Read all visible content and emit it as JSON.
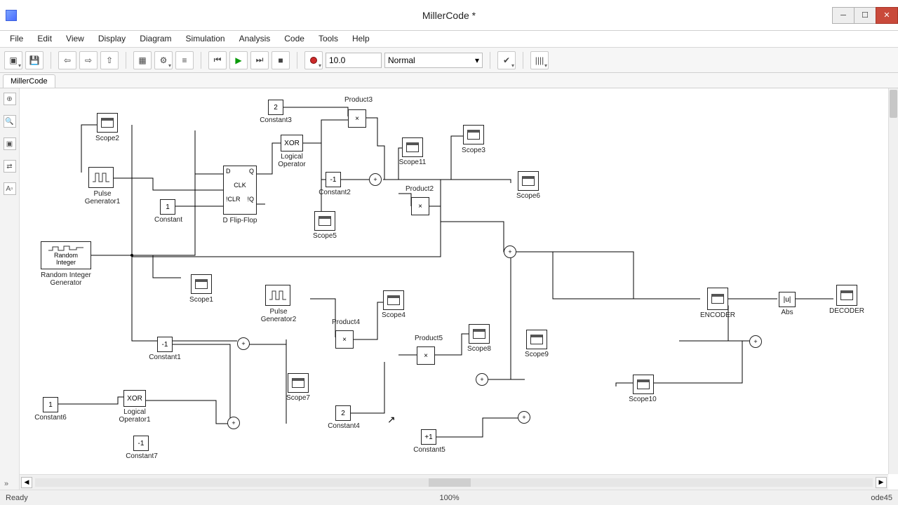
{
  "window": {
    "title": "MillerCode *"
  },
  "menu": [
    "File",
    "Edit",
    "View",
    "Display",
    "Diagram",
    "Simulation",
    "Analysis",
    "Code",
    "Tools",
    "Help"
  ],
  "toolbar": {
    "sim_time": "10.0",
    "sim_mode": "Normal"
  },
  "tab": {
    "label": "MillerCode"
  },
  "status": {
    "left": "Ready",
    "zoom": "100%",
    "solver": "ode45"
  },
  "blocks": {
    "scope2": "Scope2",
    "pulse1": "Pulse\nGenerator1",
    "rand_int_body": "Random\nInteger",
    "rand_int": "Random Integer\nGenerator",
    "constant": "Constant",
    "constant_val": "1",
    "constant1": "Constant1",
    "constant1_val": "-1",
    "constant2": "Constant2",
    "constant2_val": "-1",
    "constant3": "Constant3",
    "constant3_val": "2",
    "constant4": "Constant4",
    "constant4_val": "2",
    "constant5": "Constant5",
    "constant5_val": "+1",
    "constant6": "Constant6",
    "constant6_val": "1",
    "constant7": "Constant7",
    "constant7_val": "-1",
    "dff": "D Flip-Flop",
    "dff_D": "D",
    "dff_CLK": "CLK",
    "dff_CLR": "!CLR",
    "dff_Q": "Q",
    "dff_NQ": "!Q",
    "xor": "XOR",
    "logop": "Logical\nOperator",
    "xor1": "XOR",
    "logop1": "Logical\nOperator1",
    "product2": "Product2",
    "product3": "Product3",
    "product4": "Product4",
    "product5": "Product5",
    "mult": "×",
    "scope1": "Scope1",
    "scope3": "Scope3",
    "scope4": "Scope4",
    "scope5": "Scope5",
    "scope6": "Scope6",
    "scope7": "Scope7",
    "scope8": "Scope8",
    "scope9": "Scope9",
    "scope10": "Scope10",
    "scope11": "Scope11",
    "pulse2": "Pulse\nGenerator2",
    "encoder": "ENCODER",
    "decoder": "DECODER",
    "abs": "Abs",
    "abs_val": "|u|"
  }
}
